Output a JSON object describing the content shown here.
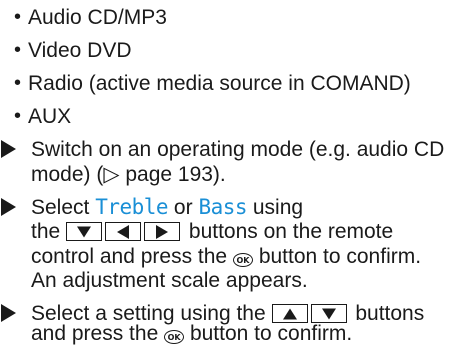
{
  "sources": [
    {
      "text": "Audio CD/MP3"
    },
    {
      "text": "Video DVD"
    },
    {
      "text": "Radio (active media source in COMAND)"
    },
    {
      "text": "AUX"
    }
  ],
  "steps": {
    "s1_line1": "Switch on an operating mode (e.g. audio CD",
    "s1_line2": "mode) (▷ page 193).",
    "s2_pre": "Select",
    "s2_treble": "Treble",
    "s2_or": "or",
    "s2_bass": "Bass",
    "s2_using": "using",
    "s2_the": "the",
    "s2_after_buttons": "buttons on the remote",
    "s2_line3_pre": "control and press the",
    "s2_line3_post": "button to confirm.",
    "s2_line4": "An adjustment scale appears.",
    "s3_line1_pre": "Select a setting using the",
    "s3_line1_post": "buttons",
    "s3_line2_pre": "and press the",
    "s3_line2_post": "button to confirm."
  },
  "ok_label": "OK",
  "icons": {
    "down": "down-arrow-button",
    "left": "left-arrow-button",
    "right": "right-arrow-button",
    "up": "up-arrow-button",
    "bullet_step": "right-pointing-triangle"
  },
  "colors": {
    "keyword": "#1a8fd6",
    "text": "#1a1a1a"
  }
}
